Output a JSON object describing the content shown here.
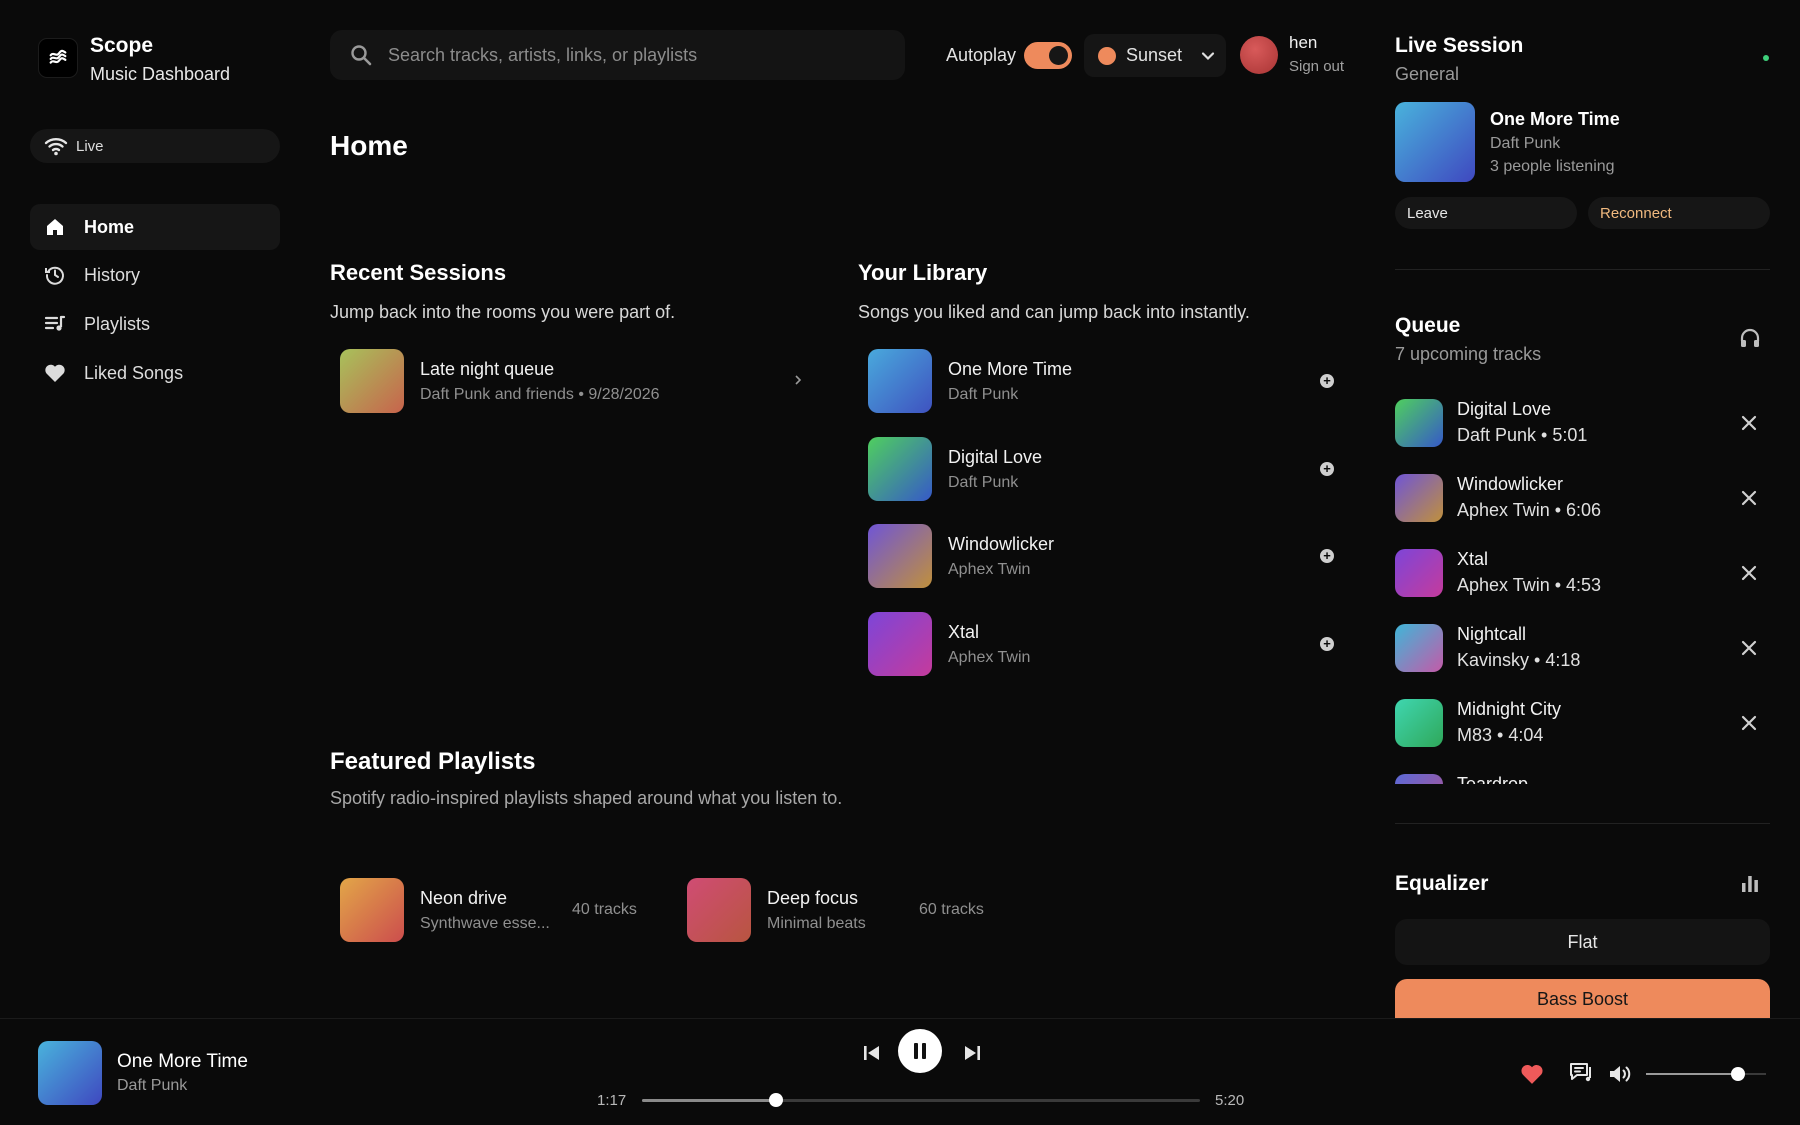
{
  "brand": {
    "title": "Scope",
    "subtitle": "Music Dashboard"
  },
  "status": {
    "label": "Live"
  },
  "nav": [
    {
      "label": "Home",
      "icon": "home-icon",
      "active": true
    },
    {
      "label": "History",
      "icon": "history-icon"
    },
    {
      "label": "Playlists",
      "icon": "playlist-icon"
    },
    {
      "label": "Liked Songs",
      "icon": "heart-icon"
    }
  ],
  "search": {
    "placeholder": "Search tracks, artists, links, or playlists",
    "value": ""
  },
  "autoplay": {
    "label": "Autoplay",
    "on": true
  },
  "theme": {
    "selected": "Sunset",
    "color": "#ee8a5c"
  },
  "user": {
    "name": "hen",
    "signout": "Sign out"
  },
  "page": {
    "title": "Home"
  },
  "recent": {
    "title": "Recent Sessions",
    "subtitle": "Jump back into the rooms you were part of.",
    "items": [
      {
        "title": "Late night queue",
        "sub": "Daft Punk and friends • 9/28/2026"
      }
    ]
  },
  "library": {
    "title": "Your Library",
    "subtitle": "Songs you liked and can jump back into instantly.",
    "items": [
      {
        "title": "One More Time",
        "artist": "Daft Punk"
      },
      {
        "title": "Digital Love",
        "artist": "Daft Punk"
      },
      {
        "title": "Windowlicker",
        "artist": "Aphex Twin"
      },
      {
        "title": "Xtal",
        "artist": "Aphex Twin"
      }
    ]
  },
  "featured": {
    "title": "Featured Playlists",
    "subtitle": "Spotify radio-inspired playlists shaped around what you listen to.",
    "items": [
      {
        "title": "Neon drive",
        "sub": "Synthwave esse...",
        "count": "40 tracks"
      },
      {
        "title": "Deep focus",
        "sub": "Minimal beats",
        "count": "60 tracks"
      }
    ]
  },
  "session": {
    "title": "Live Session",
    "channel": "General",
    "track": "One More Time",
    "artist": "Daft Punk",
    "listeners": "3 people listening",
    "leave": "Leave",
    "reconnect": "Reconnect"
  },
  "queue": {
    "title": "Queue",
    "subtitle": "7 upcoming tracks",
    "items": [
      {
        "title": "Digital Love",
        "sub": "Daft Punk • 5:01"
      },
      {
        "title": "Windowlicker",
        "sub": "Aphex Twin • 6:06"
      },
      {
        "title": "Xtal",
        "sub": "Aphex Twin • 4:53"
      },
      {
        "title": "Nightcall",
        "sub": "Kavinsky • 4:18"
      },
      {
        "title": "Midnight City",
        "sub": "M83 • 4:04"
      },
      {
        "title": "Teardrop",
        "sub": ""
      }
    ]
  },
  "equalizer": {
    "title": "Equalizer",
    "presets": [
      "Flat",
      "Bass Boost"
    ],
    "selected": "Bass Boost"
  },
  "player": {
    "track": "One More Time",
    "artist": "Daft Punk",
    "elapsed": "1:17",
    "duration": "5:20",
    "progress": 0.24,
    "volume": 0.77,
    "liked": true
  },
  "colors": {
    "accent": "#ee8a5c",
    "accent_text": "#f0b97f",
    "live_dot": "#3ecf7a"
  }
}
